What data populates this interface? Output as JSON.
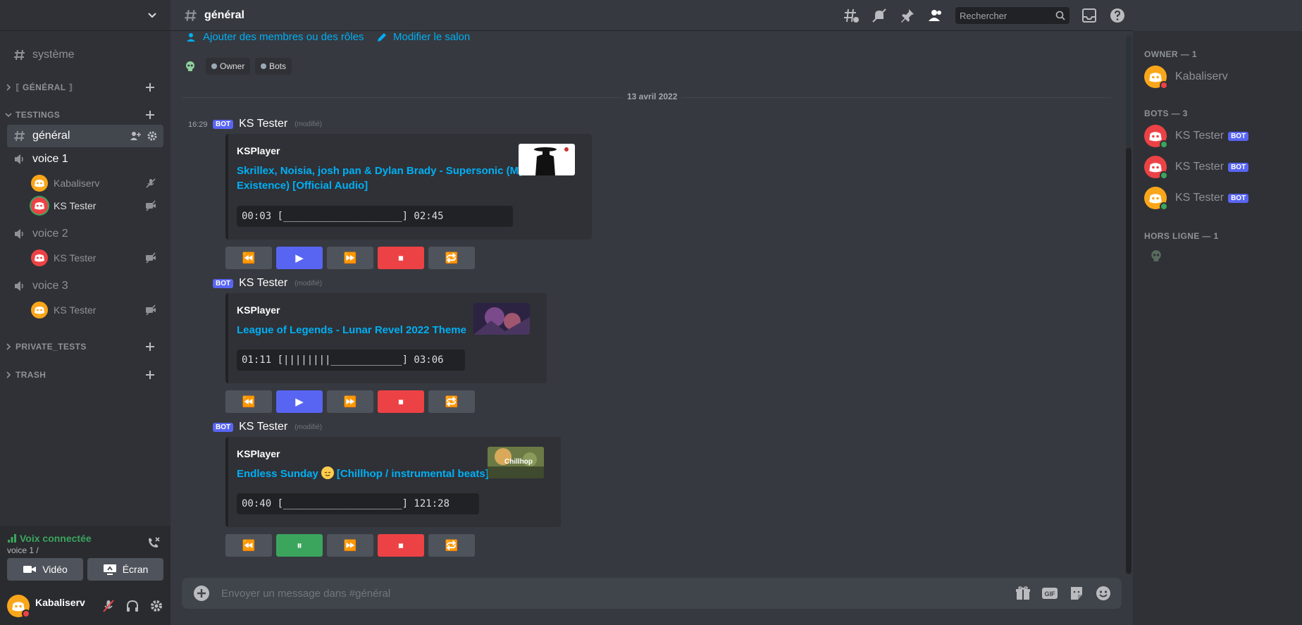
{
  "sidebar": {
    "channels": {
      "systeme": "système",
      "general": "général"
    },
    "categories": {
      "general": "⟦ GÉNÉRAL ⟧",
      "testings": "TESTINGS",
      "private_tests": "PRIVATE_TESTS",
      "trash": "TRASH"
    },
    "voice_channels": [
      {
        "name": "voice 1",
        "users": [
          "Kabaliserv",
          "KS Tester"
        ]
      },
      {
        "name": "voice 2",
        "users": [
          "KS Tester"
        ]
      },
      {
        "name": "voice 3",
        "users": [
          "KS Tester"
        ]
      }
    ],
    "voice_panel": {
      "status": "Voix connectée",
      "sub": "voice 1 /",
      "video_label": "Vidéo",
      "screen_label": "Écran"
    },
    "user": {
      "name": "Kabaliserv"
    }
  },
  "header": {
    "channel": "général",
    "search_placeholder": "Rechercher"
  },
  "channel_intro": {
    "add_members": "Ajouter des membres ou des rôles",
    "edit_channel": "Modifier le salon",
    "roles": [
      "Owner",
      "Bots"
    ]
  },
  "date_separator": "13 avril 2022",
  "messages": [
    {
      "time": "16:29",
      "bot_tag": "BOT",
      "author": "KS Tester",
      "edited": "(modifié)",
      "embed": {
        "author": "KSPlayer",
        "title_line1": "Skrillex, Noisia, josh pan & Dylan Brady - Supersonic (My",
        "title_line2": "Existence) [Official Audio]",
        "progress": "00:03 [____________________] 02:45"
      },
      "state": "paused"
    },
    {
      "bot_tag": "BOT",
      "author": "KS Tester",
      "edited": "(modifié)",
      "embed": {
        "author": "KSPlayer",
        "title": "League of Legends - Lunar Revel 2022 Theme",
        "progress": "01:11 [||||||||____________] 03:06"
      },
      "state": "paused"
    },
    {
      "bot_tag": "BOT",
      "author": "KS Tester",
      "edited": "(modifié)",
      "embed": {
        "author": "KSPlayer",
        "title_before": "Endless Sunday",
        "title_after": "[Chillhop / instrumental beats]",
        "progress": "00:40 [____________________] 121:28",
        "thumb_text": "Chillhop"
      },
      "state": "playing"
    }
  ],
  "controls": {
    "rewind": "⏪",
    "play": "▶",
    "pause": "⏸",
    "forward": "⏩",
    "stop": "⏹",
    "loop": "🔁"
  },
  "composer": {
    "placeholder": "Envoyer un message dans #général"
  },
  "members": {
    "owner_header": "OWNER — 1",
    "owner": "Kabaliserv",
    "bots_header": "BOTS — 3",
    "bots": [
      "KS Tester",
      "KS Tester",
      "KS Tester"
    ],
    "bot_tag": "BOT",
    "offline_header": "HORS LIGNE — 1"
  },
  "colors": {
    "accent": "#5865f2",
    "online": "#3ba55d",
    "dnd": "#ed4245",
    "link": "#00aff4"
  }
}
